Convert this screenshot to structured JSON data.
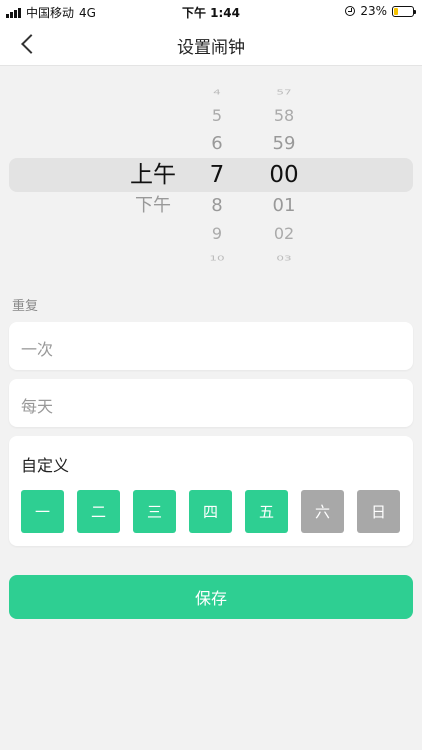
{
  "status_bar": {
    "carrier": "中国移动",
    "network": "4G",
    "time": "下午 1:44",
    "battery": "23%",
    "battery_level": 0.23
  },
  "nav": {
    "title": "设置闹钟"
  },
  "picker": {
    "ampm": {
      "items": [
        "上午",
        "下午"
      ],
      "selected": "上午"
    },
    "hour": {
      "items": [
        "4",
        "5",
        "6",
        "7",
        "8",
        "9",
        "10"
      ],
      "selected": "7"
    },
    "minute": {
      "items": [
        "57",
        "58",
        "59",
        "00",
        "01",
        "02",
        "03"
      ],
      "selected": "00"
    }
  },
  "repeat": {
    "label": "重复",
    "options": [
      "一次",
      "每天"
    ],
    "custom_label": "自定义",
    "days": [
      {
        "label": "一",
        "active": true
      },
      {
        "label": "二",
        "active": true
      },
      {
        "label": "三",
        "active": true
      },
      {
        "label": "四",
        "active": true
      },
      {
        "label": "五",
        "active": true
      },
      {
        "label": "六",
        "active": false
      },
      {
        "label": "日",
        "active": false
      }
    ]
  },
  "save_label": "保存",
  "colors": {
    "accent": "#2ecf92",
    "inactive_day": "#a8a8a8",
    "highlight": "#e3e3e3"
  }
}
